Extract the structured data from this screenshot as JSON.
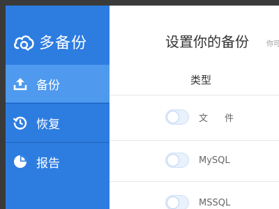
{
  "app": {
    "brand_name": "多备份"
  },
  "sidebar": {
    "items": [
      {
        "label": "备份",
        "icon": "upload-icon",
        "active": true
      },
      {
        "label": "恢复",
        "icon": "history-icon",
        "active": false
      },
      {
        "label": "报告",
        "icon": "pie-chart-icon",
        "active": false
      }
    ]
  },
  "main": {
    "title": "设置你的备份",
    "subtitle": "你可",
    "column_header": "类型",
    "rows": [
      {
        "label": "文 件",
        "enabled": false
      },
      {
        "label": "MySQL",
        "enabled": false
      },
      {
        "label": "MSSQL",
        "enabled": false
      }
    ]
  },
  "colors": {
    "sidebar": "#2d7de1",
    "sidebar_active": "#4f9aee"
  }
}
